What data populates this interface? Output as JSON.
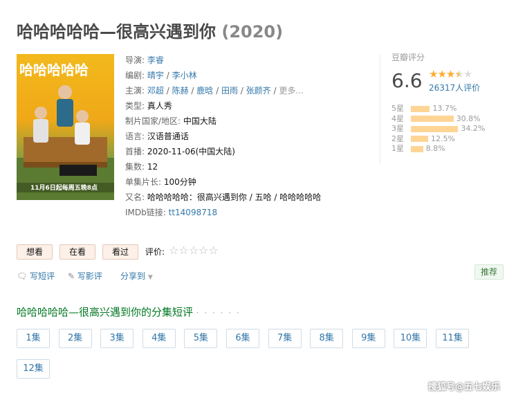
{
  "title": {
    "main": "哈哈哈哈哈—很高兴遇到你",
    "year": "(2020)"
  },
  "poster": {
    "title_art": "哈哈哈哈哈",
    "date_banner": "11月6日起每周五晚8点",
    "alt": "海报"
  },
  "info": {
    "director_label": "导演:",
    "director": "李睿",
    "writer_label": "编剧:",
    "writers": [
      "晴宇",
      "李小林"
    ],
    "cast_label": "主演:",
    "cast": [
      "邓超",
      "陈赫",
      "鹿晗",
      "田雨",
      "张颜齐"
    ],
    "cast_more": "更多...",
    "genre_label": "类型:",
    "genre": "真人秀",
    "country_label": "制片国家/地区:",
    "country": "中国大陆",
    "language_label": "语言:",
    "language": "汉语普通话",
    "premiere_label": "首播:",
    "premiere": "2020-11-06(中国大陆)",
    "episodes_label": "集数:",
    "episodes": "12",
    "runtime_label": "单集片长:",
    "runtime": "100分钟",
    "aka_label": "又名:",
    "aka": "哈哈哈哈哈：很高兴遇到你 / 五哈 / 哈哈哈哈哈",
    "imdb_label": "IMDb链接:",
    "imdb": "tt14098718"
  },
  "rating": {
    "header": "豆瓣评分",
    "score": "6.6",
    "votes": "26317人评价",
    "stars_value": 3.5,
    "distribution": [
      {
        "label": "5星",
        "pct": "13.7%",
        "value": 13.7
      },
      {
        "label": "4星",
        "pct": "30.8%",
        "value": 30.8
      },
      {
        "label": "3星",
        "pct": "34.2%",
        "value": 34.2
      },
      {
        "label": "2星",
        "pct": "12.5%",
        "value": 12.5
      },
      {
        "label": "1星",
        "pct": "8.8%",
        "value": 8.8
      }
    ]
  },
  "actions": {
    "want": "想看",
    "watching": "在看",
    "watched": "看过",
    "rate_label": "评价:"
  },
  "tools": {
    "short_review": "写短评",
    "review": "写影评",
    "share": "分享到",
    "recommend": "推荐"
  },
  "episodes_section": {
    "title": "哈哈哈哈哈—很高兴遇到你的分集短评",
    "dots": "· · · · · ·",
    "items": [
      "1集",
      "2集",
      "3集",
      "4集",
      "5集",
      "6集",
      "7集",
      "8集",
      "9集",
      "10集",
      "11集",
      "12集"
    ]
  },
  "watermark": "搜狐号@五七娱乐",
  "colors": {
    "link": "#3377aa",
    "star": "#ffac2d",
    "bar": "#ffd596",
    "section_green": "#007722"
  }
}
